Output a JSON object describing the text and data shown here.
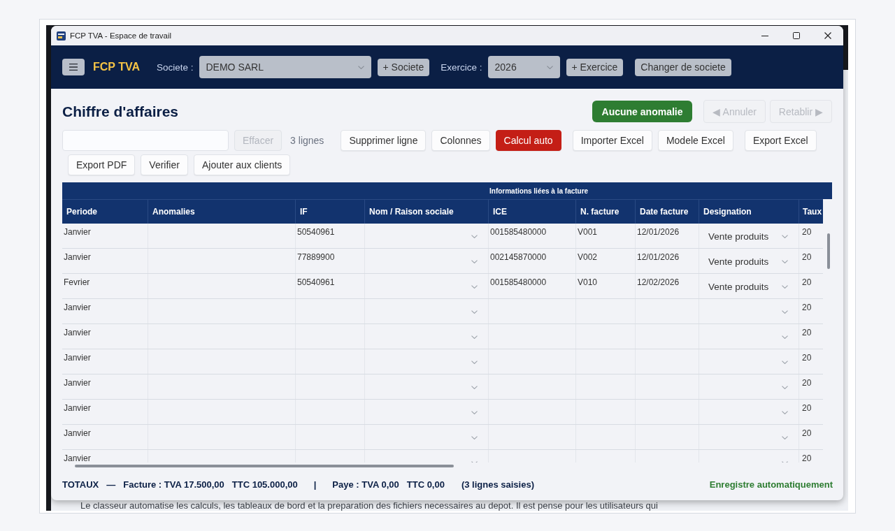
{
  "background": {
    "paragraph": "Le classeur automatise les calculs, les tableaux de bord et la preparation des fichiers necessaires au depot. Il est pense pour les utilisateurs qui"
  },
  "window": {
    "title": "FCP TVA - Espace de travail"
  },
  "header": {
    "brand": "FCP TVA",
    "company": {
      "label": "Societe :",
      "value": "DEMO SARL",
      "add_button": "+ Societe"
    },
    "year": {
      "label": "Exercice :",
      "value": "2026",
      "add_button": "+ Exercice"
    },
    "switch_button": "Changer de societe"
  },
  "page": {
    "title": "Chiffre d'affaires",
    "status": {
      "label": "Aucune anomalie",
      "ok": true
    },
    "history": [
      {
        "label": "◀ Annuler",
        "disabled": true
      },
      {
        "label": "Retablir ▶",
        "disabled": true
      }
    ]
  },
  "toolbar": {
    "rows": [
      {
        "groups": [
          {
            "items": [
              {
                "kind": "search"
              },
              {
                "kind": "button",
                "label": "Effacer",
                "disabled": true,
                "highlighted": false
              },
              {
                "kind": "count",
                "text": "3 lignes"
              }
            ]
          },
          {
            "items": [
              {
                "kind": "button",
                "label": "Supprimer ligne",
                "disabled": false,
                "highlighted": false
              },
              {
                "kind": "button",
                "label": "Colonnes",
                "disabled": false,
                "highlighted": false
              },
              {
                "kind": "button",
                "label": "Calcul auto",
                "disabled": false,
                "highlighted": true
              }
            ]
          },
          {
            "items": [
              {
                "kind": "button",
                "label": "Importer Excel",
                "disabled": false,
                "highlighted": false
              },
              {
                "kind": "button",
                "label": "Modele Excel",
                "disabled": false,
                "highlighted": false
              }
            ]
          },
          {
            "items": [
              {
                "kind": "button",
                "label": "Export Excel",
                "disabled": false,
                "highlighted": false
              }
            ]
          }
        ]
      },
      {
        "groups": [
          {
            "items": [
              {
                "kind": "button",
                "label": "Export PDF",
                "disabled": false,
                "highlighted": false
              },
              {
                "kind": "button",
                "label": "Verifier",
                "disabled": false,
                "highlighted": false
              },
              {
                "kind": "button",
                "label": "Ajouter aux clients",
                "disabled": false,
                "highlighted": false
              }
            ]
          }
        ]
      }
    ]
  },
  "table": {
    "group_header": "Informations liées à la facture",
    "columns": [
      {
        "label": "Periode",
        "kind": "text"
      },
      {
        "label": "Anomalies",
        "kind": "text"
      },
      {
        "label": "IF",
        "kind": "text"
      },
      {
        "label": "Nom / Raison sociale",
        "kind": "select"
      },
      {
        "label": "ICE",
        "kind": "text"
      },
      {
        "label": "N. facture",
        "kind": "text"
      },
      {
        "label": "Date facture",
        "kind": "text"
      },
      {
        "label": "Designation",
        "kind": "select"
      },
      {
        "label": "Taux",
        "kind": "text"
      }
    ],
    "rows": [
      {
        "periode": "Janvier",
        "if": "50540961",
        "ice": "001585480000",
        "n_facture": "V001",
        "date_facture": "12/01/2026",
        "designation": "Vente produits",
        "taux": "20"
      },
      {
        "periode": "Janvier",
        "if": "77889900",
        "ice": "002145870000",
        "n_facture": "V002",
        "date_facture": "12/01/2026",
        "designation": "Vente produits",
        "taux": "20"
      },
      {
        "periode": "Fevrier",
        "if": "50540961",
        "ice": "001585480000",
        "n_facture": "V010",
        "date_facture": "12/02/2026",
        "designation": "Vente produits",
        "taux": "20"
      },
      {
        "periode": "Janvier",
        "taux": "20"
      },
      {
        "periode": "Janvier",
        "taux": "20"
      },
      {
        "periode": "Janvier",
        "taux": "20"
      },
      {
        "periode": "Janvier",
        "taux": "20"
      },
      {
        "periode": "Janvier",
        "taux": "20"
      },
      {
        "periode": "Janvier",
        "taux": "20"
      },
      {
        "periode": "Janvier",
        "taux": "20"
      }
    ]
  },
  "totals": {
    "label": "TOTAUX",
    "dash": "—",
    "invoiced": [
      "Facture : TVA 17.500,00",
      "TTC 105.000,00"
    ],
    "separator": "|",
    "paid": [
      "Paye : TVA 0,00",
      "TTC 0,00"
    ],
    "count": "(3 lignes saisies)"
  },
  "save_status": "Enregistre automatiquement"
}
